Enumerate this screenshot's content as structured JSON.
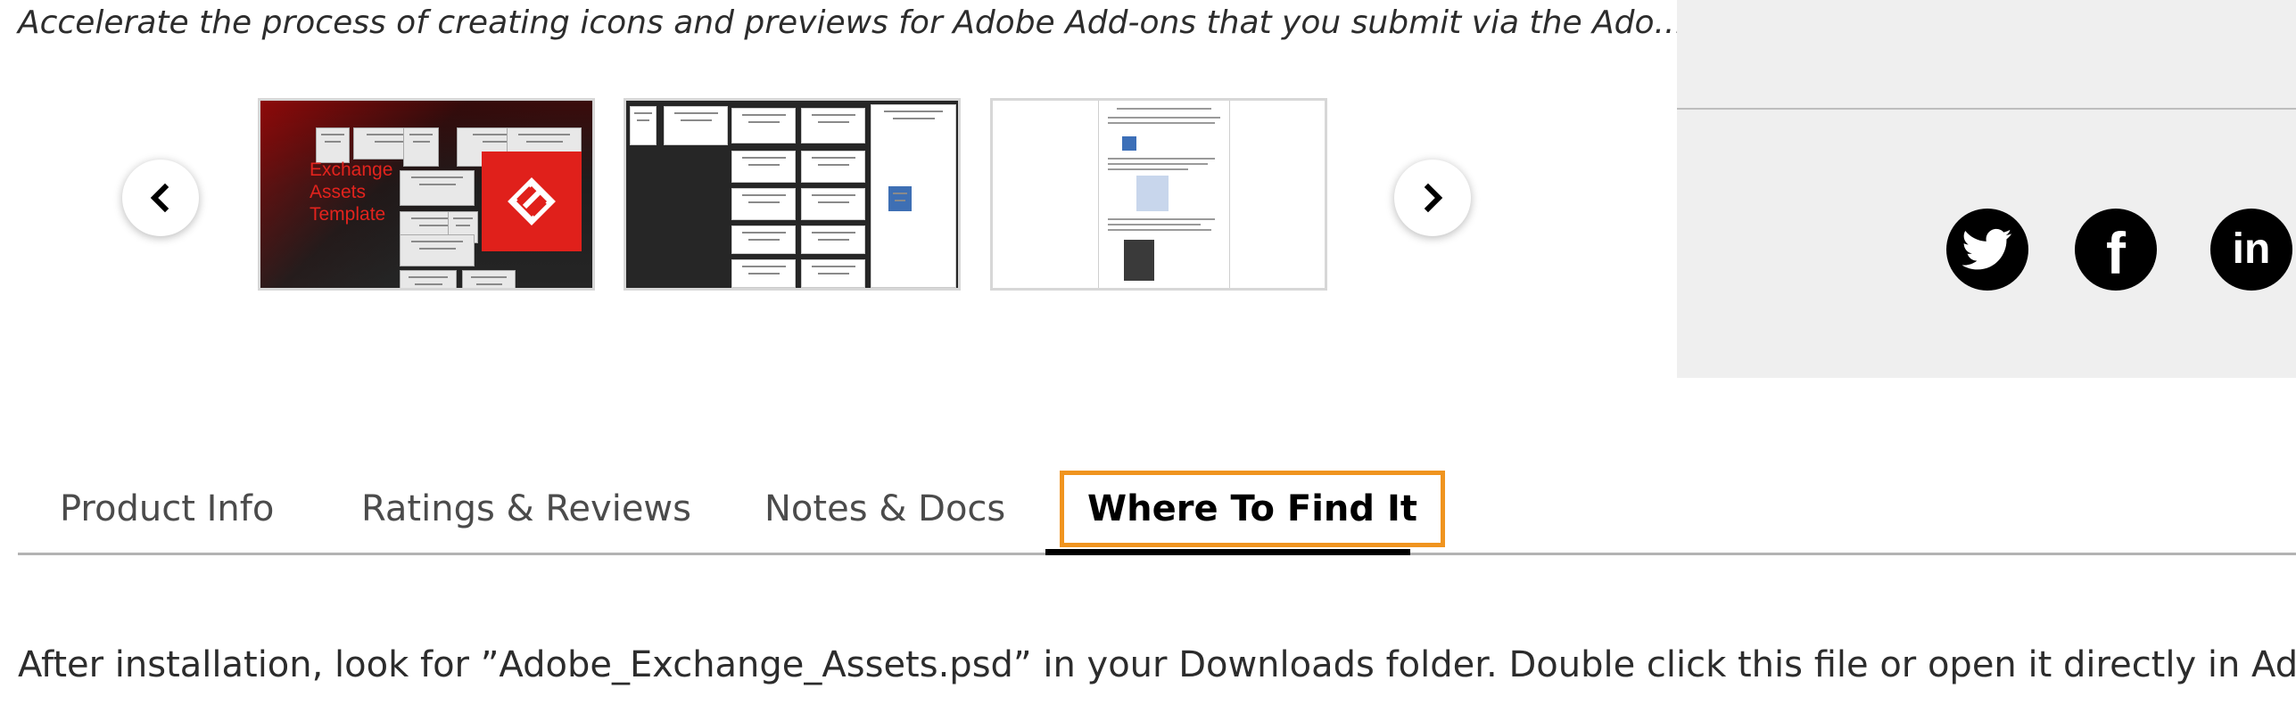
{
  "description": "Accelerate the process of creating icons and previews for Adobe Add-ons that you submit via the Ado...",
  "carousel": {
    "prev_icon": "chevron-left-icon",
    "next_icon": "chevron-right-icon",
    "thumbnails": [
      {
        "label_line1": "Exchange",
        "label_line2": "Assets",
        "label_line3": "Template",
        "accent": "#e0201b"
      },
      {
        "accent": "#262626"
      },
      {
        "accent": "#ffffff"
      }
    ]
  },
  "social": {
    "items": [
      {
        "name": "twitter",
        "icon": "twitter-icon"
      },
      {
        "name": "facebook",
        "icon": "facebook-icon",
        "glyph": "f"
      },
      {
        "name": "linkedin",
        "icon": "linkedin-icon",
        "glyph": "in"
      }
    ]
  },
  "tabs": [
    {
      "label": "Product Info",
      "active": false
    },
    {
      "label": "Ratings & Reviews",
      "active": false
    },
    {
      "label": "Notes & Docs",
      "active": false
    },
    {
      "label": "Where To Find It",
      "active": true
    }
  ],
  "body": {
    "text": "After installation, look for ”Adobe_Exchange_Assets.psd” in your Downloads folder. Double click this file or open it directly in Adobe Photoshop"
  },
  "colors": {
    "focus_outline": "#f0941f",
    "side_panel_bg": "#efefef",
    "brand_red": "#e0201b"
  }
}
